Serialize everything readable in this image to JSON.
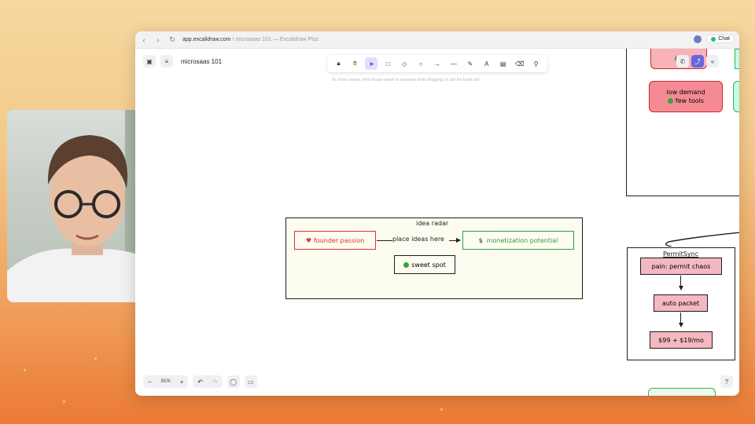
{
  "browser": {
    "url_host": "app.excalidraw.com",
    "url_rest": " / microsaas 101 — Excalidraw Plus",
    "chat_label": "Chat"
  },
  "app": {
    "doc_title": "microsaas 101",
    "hint": "To move canvas, hold mouse wheel or spacebar while dragging, or use the hand tool",
    "zoom_level": "91%"
  },
  "toolbar": {
    "tools": [
      "lock-icon",
      "hand-icon",
      "selection-icon",
      "rectangle-icon",
      "diamond-icon",
      "ellipse-icon",
      "arrow-icon",
      "line-icon",
      "draw-icon",
      "text-icon",
      "image-icon",
      "eraser-icon",
      "more-tools-icon"
    ],
    "active": "selection-icon"
  },
  "canvas": {
    "idea_radar": {
      "title": "idea radar",
      "founder_passion": "founder passion",
      "place_ideas": "place ideas here",
      "monetization": "monetization potential",
      "sweet_spot": "sweet spot",
      "dollar": "$"
    },
    "right_cards": {
      "low_demand": "low demand",
      "few_tools": "few tools"
    },
    "permitsync": {
      "title": "PermitSync",
      "step1": "pain: permit chaos",
      "step2": "auto packet",
      "step3": "$99 + $19/mo"
    }
  },
  "colors": {
    "founder_red": "#e03131",
    "monetization_green": "#2f9e44",
    "pink_fill": "#f4b8c1",
    "active_tool": "#e0dfff"
  }
}
